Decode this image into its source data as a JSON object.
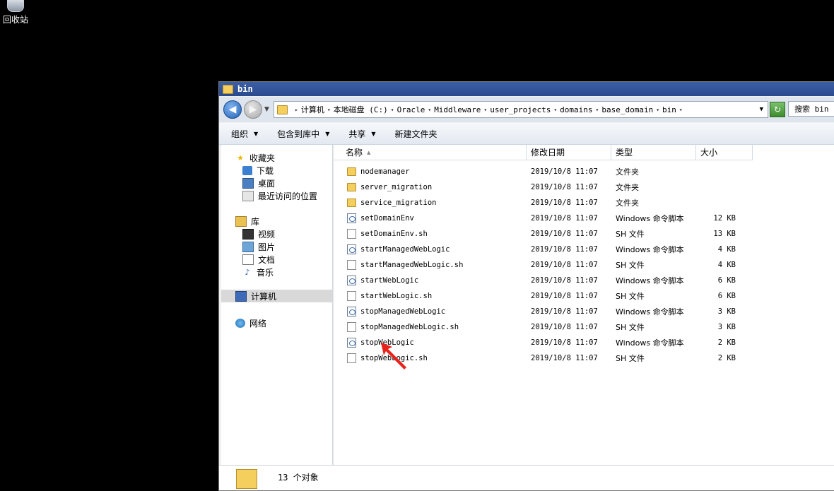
{
  "desktop": {
    "recycle_bin_label": "回收站"
  },
  "window": {
    "title": "bin",
    "breadcrumbs": [
      "计算机",
      "本地磁盘 (C:)",
      "Oracle",
      "Middleware",
      "user_projects",
      "domains",
      "base_domain",
      "bin"
    ],
    "search_placeholder": "搜索 bin"
  },
  "toolbar": {
    "organize": "组织",
    "include_in_library": "包含到库中",
    "share": "共享",
    "new_folder": "新建文件夹"
  },
  "nav": {
    "favorites": "收藏夹",
    "downloads": "下载",
    "desktop": "桌面",
    "recent": "最近访问的位置",
    "libraries": "库",
    "videos": "视频",
    "pictures": "图片",
    "documents": "文档",
    "music": "音乐",
    "computer": "计算机",
    "network": "网络"
  },
  "columns": {
    "name": "名称",
    "date": "修改日期",
    "type": "类型",
    "size": "大小"
  },
  "files": [
    {
      "name": "nodemanager",
      "date": "2019/10/8 11:07",
      "type": "文件夹",
      "size": "",
      "icon": "folder"
    },
    {
      "name": "server_migration",
      "date": "2019/10/8 11:07",
      "type": "文件夹",
      "size": "",
      "icon": "folder"
    },
    {
      "name": "service_migration",
      "date": "2019/10/8 11:07",
      "type": "文件夹",
      "size": "",
      "icon": "folder"
    },
    {
      "name": "setDomainEnv",
      "date": "2019/10/8 11:07",
      "type": "Windows 命令脚本",
      "size": "12 KB",
      "icon": "script"
    },
    {
      "name": "setDomainEnv.sh",
      "date": "2019/10/8 11:07",
      "type": "SH 文件",
      "size": "13 KB",
      "icon": "plain"
    },
    {
      "name": "startManagedWebLogic",
      "date": "2019/10/8 11:07",
      "type": "Windows 命令脚本",
      "size": "4 KB",
      "icon": "script"
    },
    {
      "name": "startManagedWebLogic.sh",
      "date": "2019/10/8 11:07",
      "type": "SH 文件",
      "size": "4 KB",
      "icon": "plain"
    },
    {
      "name": "startWebLogic",
      "date": "2019/10/8 11:07",
      "type": "Windows 命令脚本",
      "size": "6 KB",
      "icon": "script"
    },
    {
      "name": "startWebLogic.sh",
      "date": "2019/10/8 11:07",
      "type": "SH 文件",
      "size": "6 KB",
      "icon": "plain"
    },
    {
      "name": "stopManagedWebLogic",
      "date": "2019/10/8 11:07",
      "type": "Windows 命令脚本",
      "size": "3 KB",
      "icon": "script"
    },
    {
      "name": "stopManagedWebLogic.sh",
      "date": "2019/10/8 11:07",
      "type": "SH 文件",
      "size": "3 KB",
      "icon": "plain"
    },
    {
      "name": "stopWebLogic",
      "date": "2019/10/8 11:07",
      "type": "Windows 命令脚本",
      "size": "2 KB",
      "icon": "script"
    },
    {
      "name": "stopWebLogic.sh",
      "date": "2019/10/8 11:07",
      "type": "SH 文件",
      "size": "2 KB",
      "icon": "plain"
    }
  ],
  "status": {
    "count_text": "13 个对象"
  },
  "colors": {
    "title_bar": "#2a4a8e",
    "folder": "#f4cf5d",
    "pointer_arrow": "#e8231c"
  }
}
